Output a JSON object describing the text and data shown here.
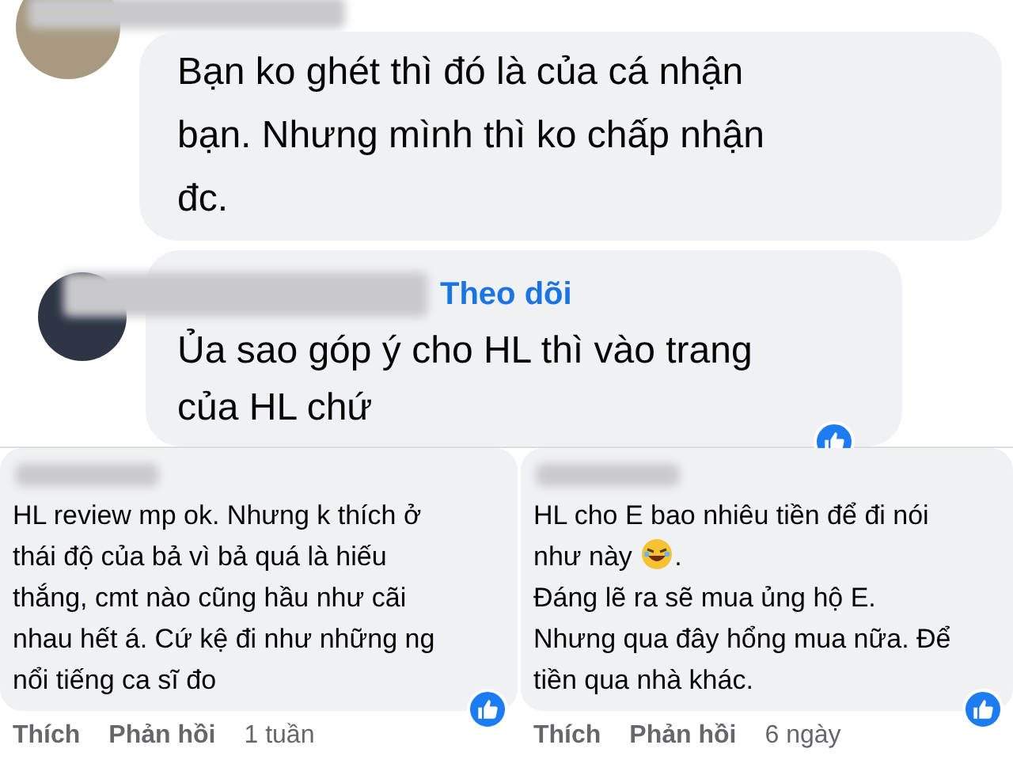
{
  "top_comments": [
    {
      "lines": [
        [
          "Bạn ko ghét thì đó là của cá nhận"
        ],
        [
          "bạn. Nhưng mình thì ko chấp nhận"
        ],
        [
          "đc."
        ]
      ]
    },
    {
      "lines": [
        [
          "Ủa sao góp ý cho HL thì vào trang"
        ],
        [
          "của HL chứ"
        ]
      ],
      "follow": "Theo dõi",
      "like_badge": true
    }
  ],
  "bottom_comments": [
    {
      "lines": [
        [
          "HL review mp ok. Nhưng k thích ở"
        ],
        [
          "thái độ của bả vì bả quá là hiếu"
        ],
        [
          "thắng, cmt nào cũng hầu như cãi"
        ],
        [
          "nhau hết á. Cứ kệ đi như những ng"
        ],
        [
          "nổi tiếng ca sĩ đo"
        ]
      ],
      "like_badge": true,
      "actions": [
        "Thích",
        "Phản hồi"
      ],
      "time": "1 tuần"
    },
    {
      "lines": [
        [
          "HL cho E bao nhiêu tiền để đi nói"
        ],
        [
          "như này ",
          {
            "kind": "emoji"
          },
          "."
        ],
        [
          "Đáng lẽ ra sẽ mua ủng hộ E."
        ],
        [
          "Nhưng qua đây hổng mua nữa. Để"
        ],
        [
          "tiền qua nhà khác."
        ]
      ],
      "like_badge": true,
      "actions": [
        "Thích",
        "Phản hồi"
      ],
      "time": "6 ngày"
    }
  ]
}
